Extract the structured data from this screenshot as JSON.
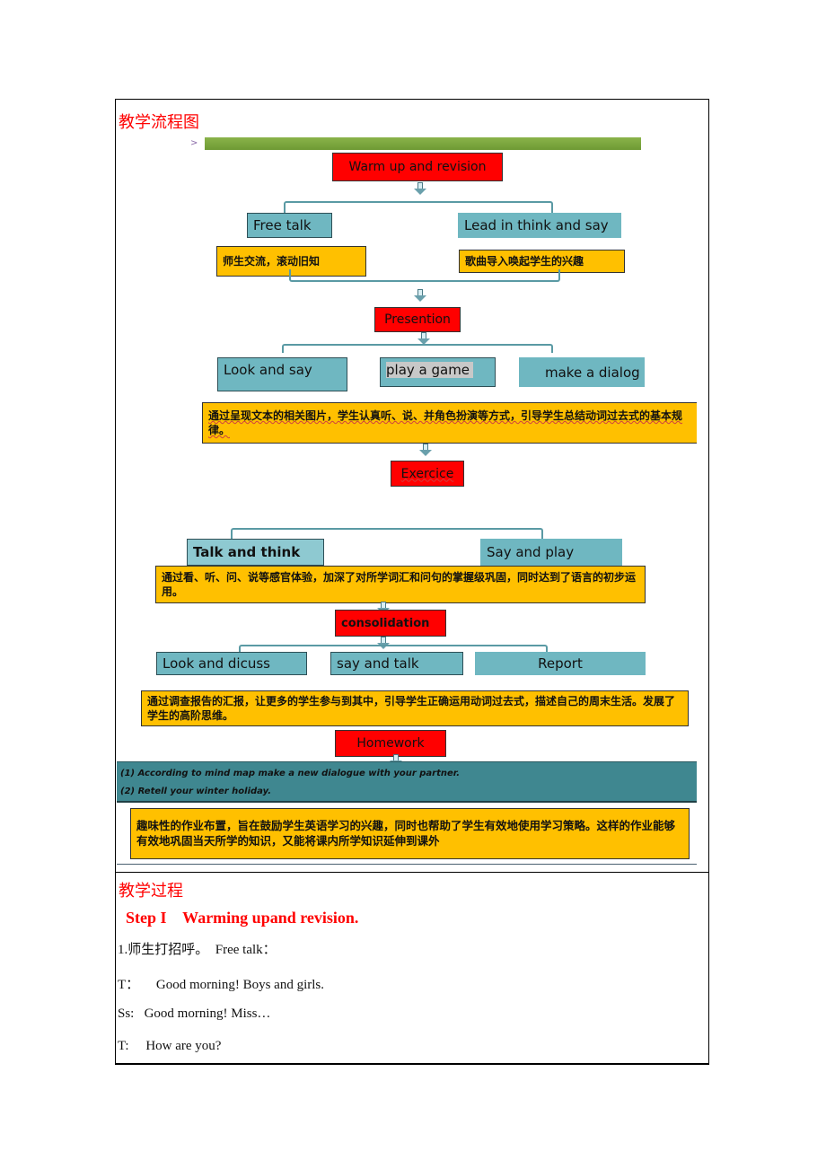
{
  "flowchart_section": {
    "title": "教学流程图",
    "nodes": {
      "warmup": "Warm up and revision",
      "free_talk": "Free talk",
      "lead_in": "Lead in think and say",
      "free_talk_note": "师生交流，滚动旧知",
      "lead_in_note": "歌曲导入唤起学生的兴趣",
      "presentation": "Presention",
      "look_and_say": "Look and say",
      "play_a_game": "play a game",
      "make_a_dialog": "make a dialog",
      "presentation_note": "通过呈现文本的相关图片，学生认真听、说、并角色扮演等方式，引导学生总结动词过去式的基本规律。",
      "exercise": "Exercice",
      "talk_and_think": "Talk and think",
      "say_and_play": "Say and play",
      "exercise_note": "通过看、听、问、说等感官体验，加深了对所学词汇和问句的掌握级巩固，同时达到了语言的初步运用。",
      "consolidation": "consolidation",
      "look_and_discuss": "Look and dicuss",
      "say_and_talk": "say and talk",
      "report": "Report",
      "consolidation_note": "通过调查报告的汇报，让更多的学生参与到其中，引导学生正确运用动词过去式，描述自己的周末生活。发展了学生的高阶思维。",
      "homework": "Homework",
      "homework_items": [
        "(1) According to mind map make a new dialogue with your partner.",
        "(2) Retell your winter holiday."
      ],
      "homework_note": "趣味性的作业布置，旨在鼓励学生英语学习的兴趣，同时也帮助了学生有效地使用学习策略。这样的作业能够有效地巩固当天所学的知识，又能将课内所学知识延伸到课外"
    }
  },
  "process_section": {
    "title": "教学过程",
    "step_title": "Step I    Warming upand revision.",
    "lines": [
      "1.师生打招呼。  Free talk：",
      "T：     Good morning! Boys and girls.",
      "Ss:   Good morning! Miss…",
      "T:     How are you?"
    ]
  },
  "colors": {
    "heading_red": "#ff0000",
    "node_red": "#ff0000",
    "node_teal": "#6fb7c1",
    "note_orange": "#ffc000",
    "homework_band": "#3f8790"
  }
}
